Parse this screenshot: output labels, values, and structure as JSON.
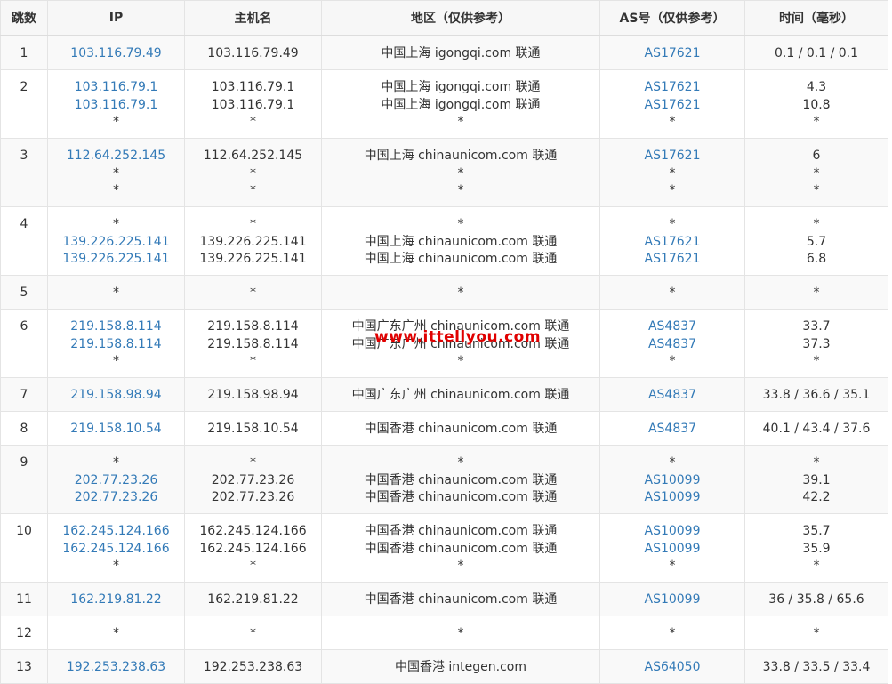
{
  "headers": {
    "hop": "跳数",
    "ip": "IP",
    "host": "主机名",
    "region": "地区（仅供参考）",
    "as": "AS号（仅供参考）",
    "time": "时间（毫秒）"
  },
  "watermark": "www.ittellyou.com",
  "rows": [
    {
      "hop": "1",
      "ip": [
        "103.116.79.49"
      ],
      "host": [
        "103.116.79.49"
      ],
      "region": [
        "中国上海 igongqi.com 联通"
      ],
      "as": [
        "AS17621"
      ],
      "time": [
        "0.1 / 0.1 / 0.1"
      ]
    },
    {
      "hop": "2",
      "ip": [
        "103.116.79.1",
        "103.116.79.1",
        "*"
      ],
      "host": [
        "103.116.79.1",
        "103.116.79.1",
        "*"
      ],
      "region": [
        "中国上海 igongqi.com 联通",
        "中国上海 igongqi.com 联通",
        "*"
      ],
      "as": [
        "AS17621",
        "AS17621",
        "*"
      ],
      "time": [
        "4.3",
        "10.8",
        "*"
      ]
    },
    {
      "hop": "3",
      "ip": [
        "112.64.252.145",
        "*",
        "*"
      ],
      "host": [
        "112.64.252.145",
        "*",
        "*"
      ],
      "region": [
        "中国上海 chinaunicom.com 联通",
        "*",
        "*"
      ],
      "as": [
        "AS17621",
        "*",
        "*"
      ],
      "time": [
        "6",
        "*",
        "*"
      ]
    },
    {
      "hop": "4",
      "ip": [
        "*",
        "139.226.225.141",
        "139.226.225.141"
      ],
      "host": [
        "*",
        "139.226.225.141",
        "139.226.225.141"
      ],
      "region": [
        "*",
        "中国上海 chinaunicom.com 联通",
        "中国上海 chinaunicom.com 联通"
      ],
      "as": [
        "*",
        "AS17621",
        "AS17621"
      ],
      "time": [
        "*",
        "5.7",
        "6.8"
      ]
    },
    {
      "hop": "5",
      "ip": [
        "*"
      ],
      "host": [
        "*"
      ],
      "region": [
        "*"
      ],
      "as": [
        "*"
      ],
      "time": [
        "*"
      ]
    },
    {
      "hop": "6",
      "ip": [
        "219.158.8.114",
        "219.158.8.114",
        "*"
      ],
      "host": [
        "219.158.8.114",
        "219.158.8.114",
        "*"
      ],
      "region": [
        "中国广东广州 chinaunicom.com 联通",
        "中国广东广州 chinaunicom.com 联通",
        "*"
      ],
      "as": [
        "AS4837",
        "AS4837",
        "*"
      ],
      "time": [
        "33.7",
        "37.3",
        "*"
      ]
    },
    {
      "hop": "7",
      "ip": [
        "219.158.98.94"
      ],
      "host": [
        "219.158.98.94"
      ],
      "region": [
        "中国广东广州 chinaunicom.com 联通"
      ],
      "as": [
        "AS4837"
      ],
      "time": [
        "33.8 / 36.6 / 35.1"
      ]
    },
    {
      "hop": "8",
      "ip": [
        "219.158.10.54"
      ],
      "host": [
        "219.158.10.54"
      ],
      "region": [
        "中国香港 chinaunicom.com 联通"
      ],
      "as": [
        "AS4837"
      ],
      "time": [
        "40.1 / 43.4 / 37.6"
      ]
    },
    {
      "hop": "9",
      "ip": [
        "*",
        "202.77.23.26",
        "202.77.23.26"
      ],
      "host": [
        "*",
        "202.77.23.26",
        "202.77.23.26"
      ],
      "region": [
        "*",
        "中国香港 chinaunicom.com 联通",
        "中国香港 chinaunicom.com 联通"
      ],
      "as": [
        "*",
        "AS10099",
        "AS10099"
      ],
      "time": [
        "*",
        "39.1",
        "42.2"
      ]
    },
    {
      "hop": "10",
      "ip": [
        "162.245.124.166",
        "162.245.124.166",
        "*"
      ],
      "host": [
        "162.245.124.166",
        "162.245.124.166",
        "*"
      ],
      "region": [
        "中国香港 chinaunicom.com 联通",
        "中国香港 chinaunicom.com 联通",
        "*"
      ],
      "as": [
        "AS10099",
        "AS10099",
        "*"
      ],
      "time": [
        "35.7",
        "35.9",
        "*"
      ]
    },
    {
      "hop": "11",
      "ip": [
        "162.219.81.22"
      ],
      "host": [
        "162.219.81.22"
      ],
      "region": [
        "中国香港 chinaunicom.com 联通"
      ],
      "as": [
        "AS10099"
      ],
      "time": [
        "36 / 35.8 / 65.6"
      ]
    },
    {
      "hop": "12",
      "ip": [
        "*"
      ],
      "host": [
        "*"
      ],
      "region": [
        "*"
      ],
      "as": [
        "*"
      ],
      "time": [
        "*"
      ]
    },
    {
      "hop": "13",
      "ip": [
        "192.253.238.63"
      ],
      "host": [
        "192.253.238.63"
      ],
      "region": [
        "中国香港 integen.com"
      ],
      "as": [
        "AS64050"
      ],
      "time": [
        "33.8 / 33.5 / 33.4"
      ]
    }
  ]
}
